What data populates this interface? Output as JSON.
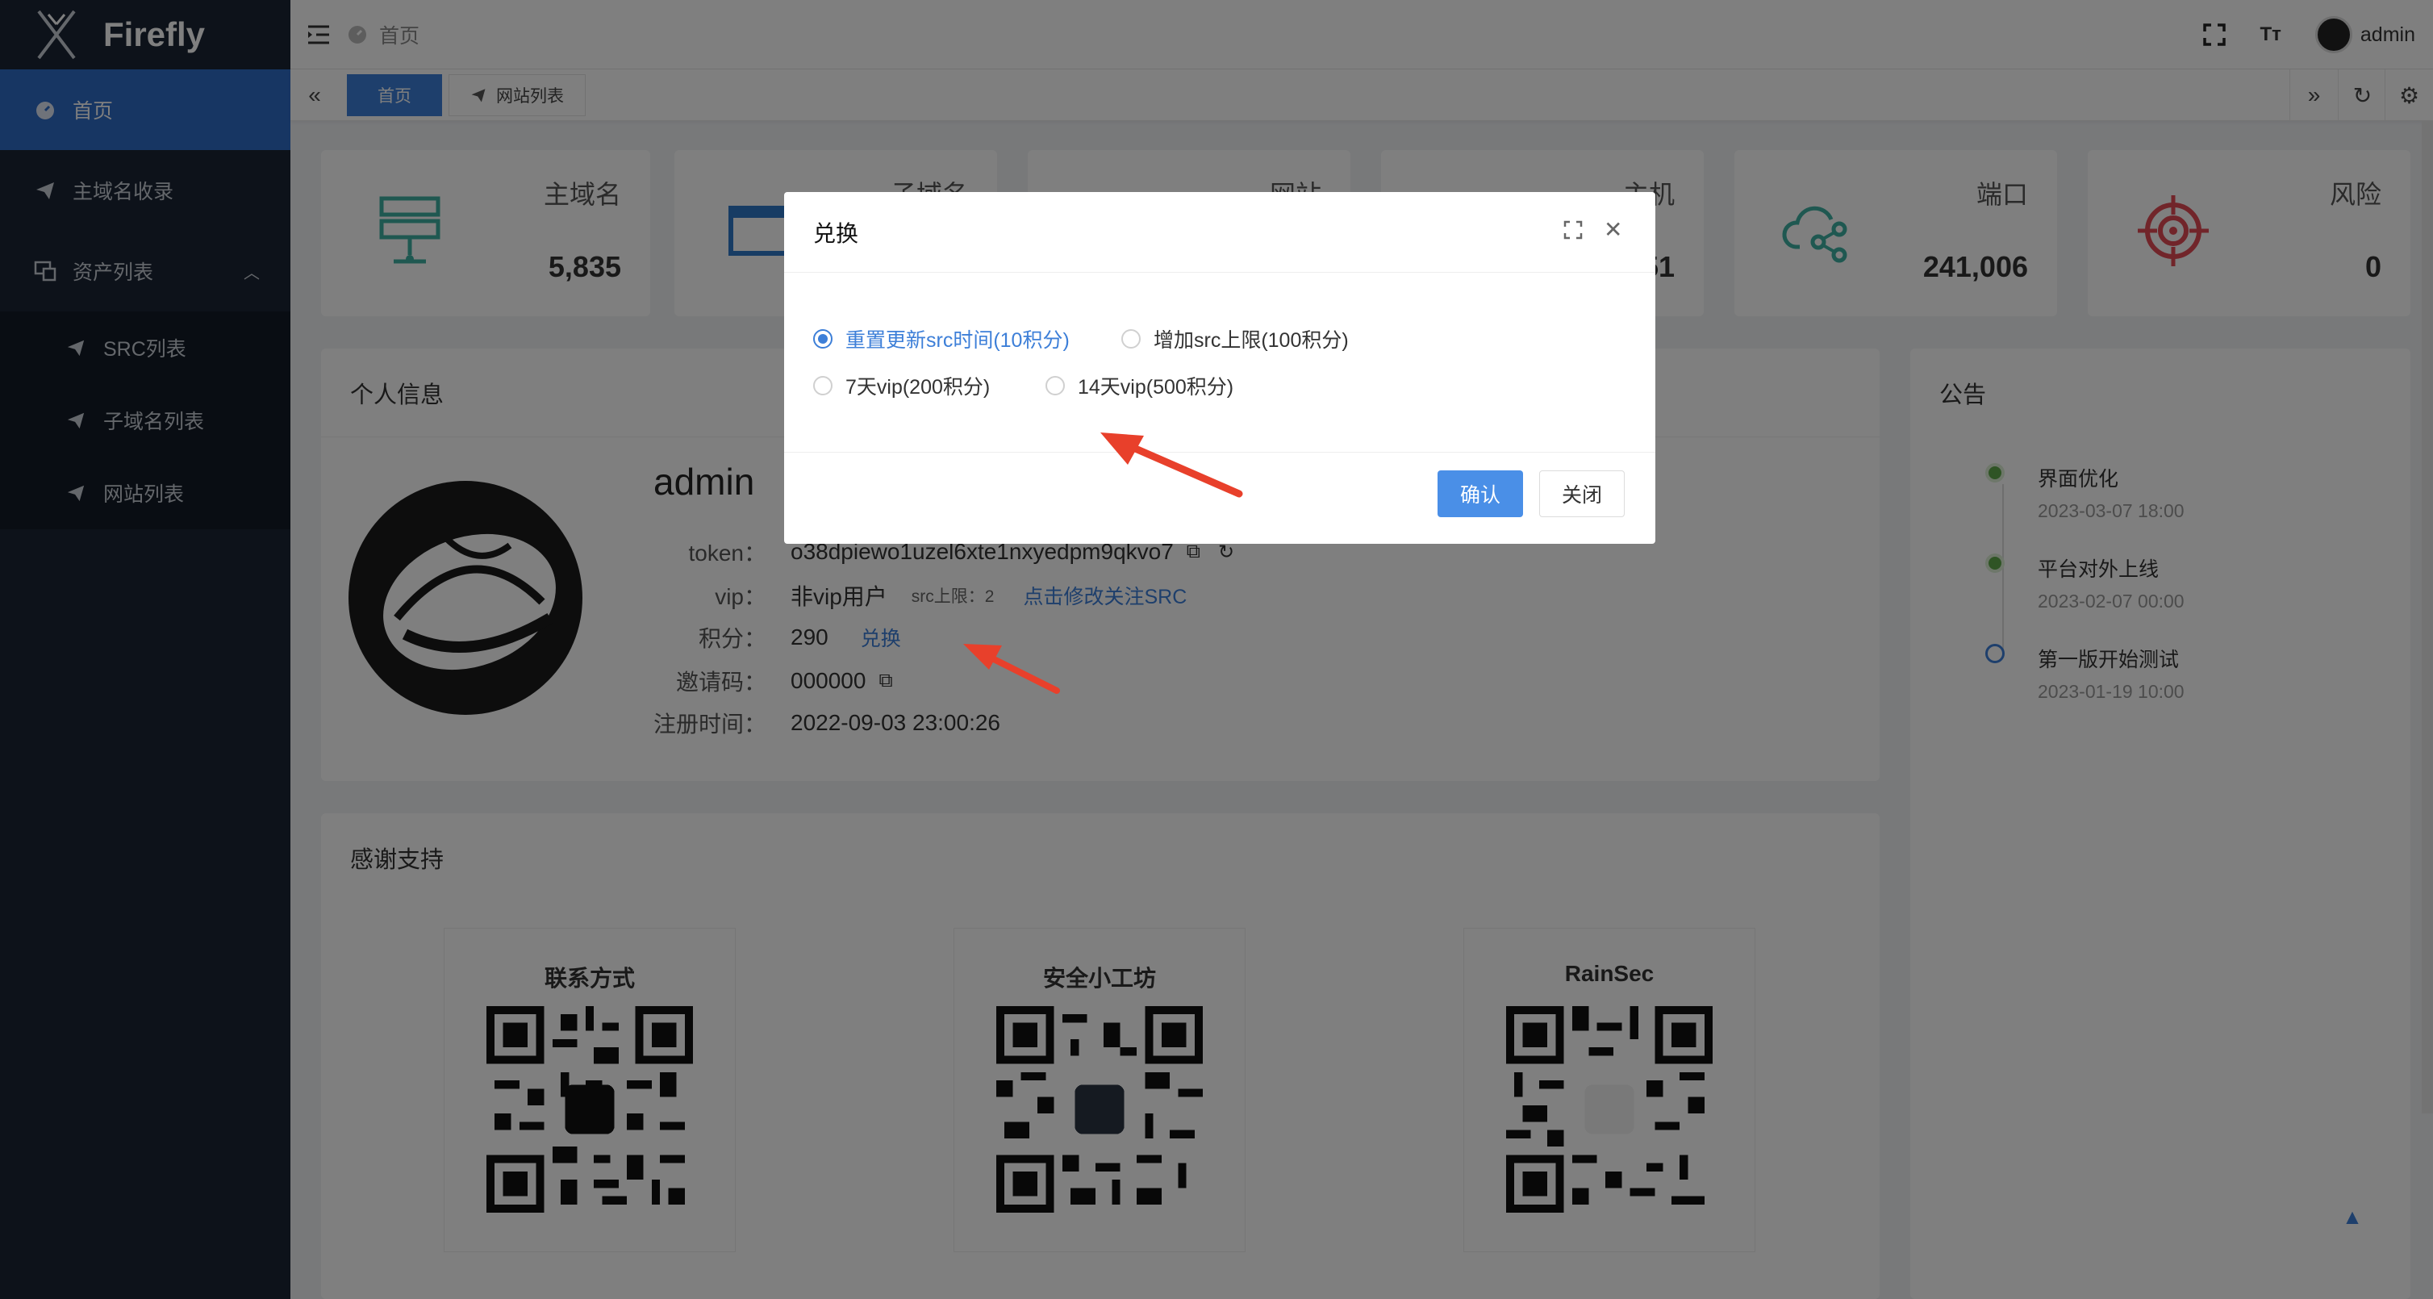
{
  "app": {
    "name": "Firefly"
  },
  "sidebar": {
    "items": [
      {
        "label": "首页",
        "icon": "dashboard-icon"
      },
      {
        "label": "主域名收录",
        "icon": "send-icon"
      },
      {
        "label": "资产列表",
        "icon": "assets-icon"
      }
    ],
    "subitems": [
      {
        "label": "SRC列表",
        "icon": "send-icon"
      },
      {
        "label": "子域名列表",
        "icon": "send-icon"
      },
      {
        "label": "网站列表",
        "icon": "send-icon"
      }
    ]
  },
  "navbar": {
    "breadcrumb": "首页",
    "user": "admin",
    "font_btn": "Tт"
  },
  "tags": [
    {
      "label": "首页"
    },
    {
      "label": "网站列表"
    }
  ],
  "stats": [
    {
      "label": "主域名",
      "value": "5,835",
      "color": "#3fb1a3",
      "icon": "server-icon"
    },
    {
      "label": "子域名",
      "value": "",
      "color": "#2f78c8",
      "icon": "window-icon"
    },
    {
      "label": "网站",
      "value": "",
      "color": "#2f78c8",
      "icon": "website-icon"
    },
    {
      "label": "主机",
      "value": "51",
      "color": "#e0a43a",
      "icon": "host-icon"
    },
    {
      "label": "端口",
      "value": "241,006",
      "color": "#3fb1a3",
      "icon": "cloud-share-icon"
    },
    {
      "label": "风险",
      "value": "0",
      "color": "#e34a55",
      "icon": "target-icon"
    }
  ],
  "profile": {
    "title": "个人信息",
    "name": "admin",
    "token_label": "token：",
    "token": "o38dpiewo1uzel6xte1nxyedpm9qkvo7",
    "vip_label": "vip：",
    "vip": "非vip用户",
    "src_limit": "src上限：2",
    "follow_link": "点击修改关注SRC",
    "points_label": "积分：",
    "points": "290",
    "exchange_link": "兑换",
    "invite_label": "邀请码：",
    "invite": "000000",
    "reg_label": "注册时间：",
    "reg_time": "2022-09-03 23:00:26"
  },
  "announcements": {
    "title": "公告",
    "items": [
      {
        "title": "界面优化",
        "time": "2023-03-07 18:00"
      },
      {
        "title": "平台对外上线",
        "time": "2023-02-07 00:00"
      },
      {
        "title": "第一版开始测试",
        "time": "2023-01-19 10:00"
      }
    ]
  },
  "thanks": {
    "title": "感谢支持",
    "cards": [
      {
        "title": "联系方式"
      },
      {
        "title": "安全小工坊"
      },
      {
        "title": "RainSec"
      }
    ]
  },
  "dialog": {
    "title": "兑换",
    "options": [
      {
        "label": "重置更新src时间(10积分)",
        "selected": true
      },
      {
        "label": "增加src上限(100积分)",
        "selected": false
      },
      {
        "label": "7天vip(200积分)",
        "selected": false
      },
      {
        "label": "14天vip(500积分)",
        "selected": false
      }
    ],
    "confirm": "确认",
    "close": "关闭"
  }
}
